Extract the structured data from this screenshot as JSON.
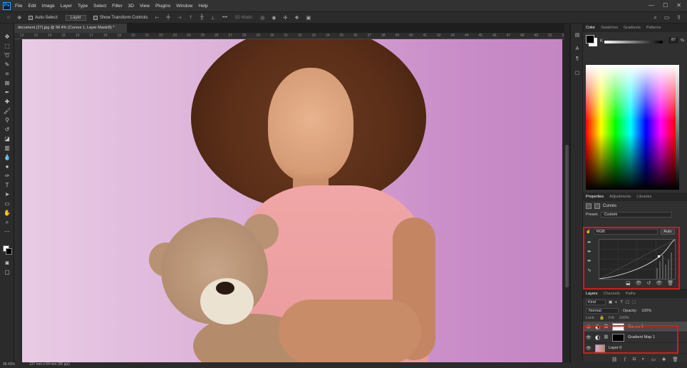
{
  "app": {
    "logo": "Ps"
  },
  "menu": [
    "File",
    "Edit",
    "Image",
    "Layer",
    "Type",
    "Select",
    "Filter",
    "3D",
    "View",
    "Plugins",
    "Window",
    "Help"
  ],
  "options_bar": {
    "auto_select_label": "Auto-Select:",
    "auto_select_value": "Layer",
    "transform_label": "Show Transform Controls",
    "mode_label": "3D Mode:"
  },
  "document": {
    "tab_title": "document (27).jpg @ 98.4% (Curves 1, Layer Mask/8) *",
    "ruler_ticks": [
      "12",
      "13",
      "14",
      "15",
      "16",
      "17",
      "18",
      "19",
      "20",
      "21",
      "22",
      "23",
      "24",
      "25",
      "26",
      "27",
      "28",
      "29",
      "30",
      "31",
      "32",
      "33",
      "34",
      "35",
      "36",
      "37",
      "38",
      "39",
      "40",
      "41",
      "42",
      "43",
      "44",
      "45",
      "46",
      "47",
      "48",
      "49",
      "50",
      "51"
    ]
  },
  "status": {
    "zoom": "98.43%",
    "size": "127 mm x 64 mm (96 ppi)"
  },
  "color_panel": {
    "tabs": [
      "Color",
      "Swatches",
      "Gradients",
      "Patterns"
    ],
    "active_tab": "Color",
    "channel": "K",
    "value": "87",
    "unit": "%"
  },
  "properties_panel": {
    "tabs": [
      "Properties",
      "Adjustments",
      "Libraries"
    ],
    "active_tab": "Properties",
    "title": "Curves",
    "preset_label": "Preset:",
    "preset_value": "Custom",
    "channel_value": "RGB",
    "auto_label": "Auto"
  },
  "layers_panel": {
    "tabs": [
      "Layers",
      "Channels",
      "Paths"
    ],
    "active_tab": "Layers",
    "filter_kind": "Kind",
    "blend_mode": "Normal",
    "opacity_label": "Opacity:",
    "opacity_value": "100%",
    "lock_label": "Lock:",
    "fill_label": "Fill:",
    "fill_value": "100%",
    "layers": [
      {
        "name": "Curves 1",
        "type": "adjustment",
        "mask": "white",
        "selected": true
      },
      {
        "name": "Gradient Map 1",
        "type": "adjustment",
        "mask": "black",
        "selected": false
      },
      {
        "name": "Layer 0",
        "type": "pixel",
        "selected": false
      }
    ]
  },
  "highlight_color": "#e3141a"
}
